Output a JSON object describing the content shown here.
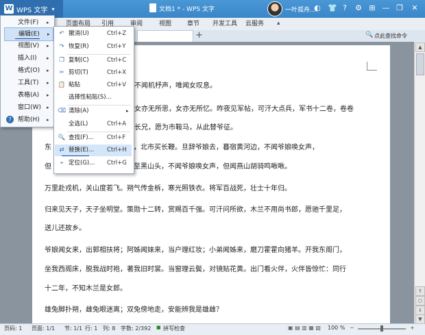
{
  "app": {
    "button_label": "WPS 文字",
    "logo_letter": "W",
    "title": "文档1 * - WPS 文字",
    "user": "一叶孤舟..."
  },
  "ribbon_tabs": [
    "页面布局",
    "引用",
    "审阅",
    "视图",
    "章节",
    "开发工具",
    "云服务"
  ],
  "help_search": "点此查找命令",
  "app_menu": [
    {
      "label": "文件(F)",
      "arrow": true
    },
    {
      "label": "编辑(E)",
      "arrow": true
    },
    {
      "label": "视图(V)",
      "arrow": true
    },
    {
      "label": "插入(I)",
      "arrow": true
    },
    {
      "label": "格式(O)",
      "arrow": true
    },
    {
      "label": "工具(T)",
      "arrow": true
    },
    {
      "label": "表格(A)",
      "arrow": true
    },
    {
      "label": "窗口(W)",
      "arrow": true
    },
    {
      "label": "帮助(H)",
      "arrow": true
    }
  ],
  "edit_menu": [
    {
      "label": "撤消(U)",
      "shortcut": "Ctrl+Z",
      "icon": "↶"
    },
    {
      "label": "恢复(R)",
      "shortcut": "Ctrl+Y",
      "icon": "↷"
    },
    {
      "label": "复制(C)",
      "shortcut": "Ctrl+C",
      "icon": "❐"
    },
    {
      "label": "剪切(T)",
      "shortcut": "Ctrl+X",
      "icon": "✂"
    },
    {
      "label": "粘贴",
      "shortcut": "Ctrl+V",
      "icon": "📋"
    },
    {
      "label": "选择性粘贴(S)...",
      "shortcut": "",
      "icon": ""
    },
    {
      "label": "清除(A)",
      "shortcut": "",
      "icon": "⌫"
    },
    {
      "label": "全选(L)",
      "shortcut": "Ctrl+A",
      "icon": ""
    },
    {
      "label": "查找(F)...",
      "shortcut": "Ctrl+F",
      "icon": "🔍"
    },
    {
      "label": "替换(E)...",
      "shortcut": "Ctrl+H",
      "icon": "⇄"
    },
    {
      "label": "定位(G)...",
      "shortcut": "Ctrl+G",
      "icon": "⌖"
    }
  ],
  "document_lines": [
    "。不闻机杼声，唯闻女叹息。",
    "女亦无所思，女亦无所忆。昨夜见军帖，可汗大点兵，军书十二卷，卷卷",
    "长兄，愿为市鞍马，从此替爷征。",
    "东　　　　　　　南市买辔头，北市买长鞭。旦辞爷娘去，暮宿黄河边，不闻爷娘唤女声，",
    "但　　　　　　　黄河去，暮至黑山头，不闻爷娘唤女声，但闻燕山胡骑鸣啾啾。",
    "万里赴戎机，关山度若飞。朔气传金柝，寒光照铁衣。将军百战死，壮士十年归。",
    "归来见天子，天子坐明堂。策勋十二转，赏赐百千强。可汗问所欲，木兰不用尚书郎，愿驰千里足，",
    "送儿还故乡。",
    "爷娘闻女来，出郭相扶将；阿姊闻妹来，当户理红妆；小弟闻姊来，磨刀霍霍向猪羊。开我东阁门，",
    "坐我西阁床，脱我战时袍，著我旧时裳。当窗理云鬓，对镜贴花黄。出门看火伴，火伴皆惊忙：同行",
    "十二年，不知木兰是女郎。",
    "雄兔脚扑朔，雌兔眼迷离；双兔傍地走，安能辨我是雄雌？"
  ],
  "status": {
    "page_num": "页码: 1",
    "pages": "页面: 1/1",
    "section": "节: 1/1",
    "row": "行: 1",
    "col": "列: 8",
    "words": "字数: 2/392",
    "spell": "拼写检查",
    "zoom": "100 %"
  },
  "colors": {
    "titlebar": "#3a86c8",
    "menu_highlight": "#cfe2f7"
  }
}
